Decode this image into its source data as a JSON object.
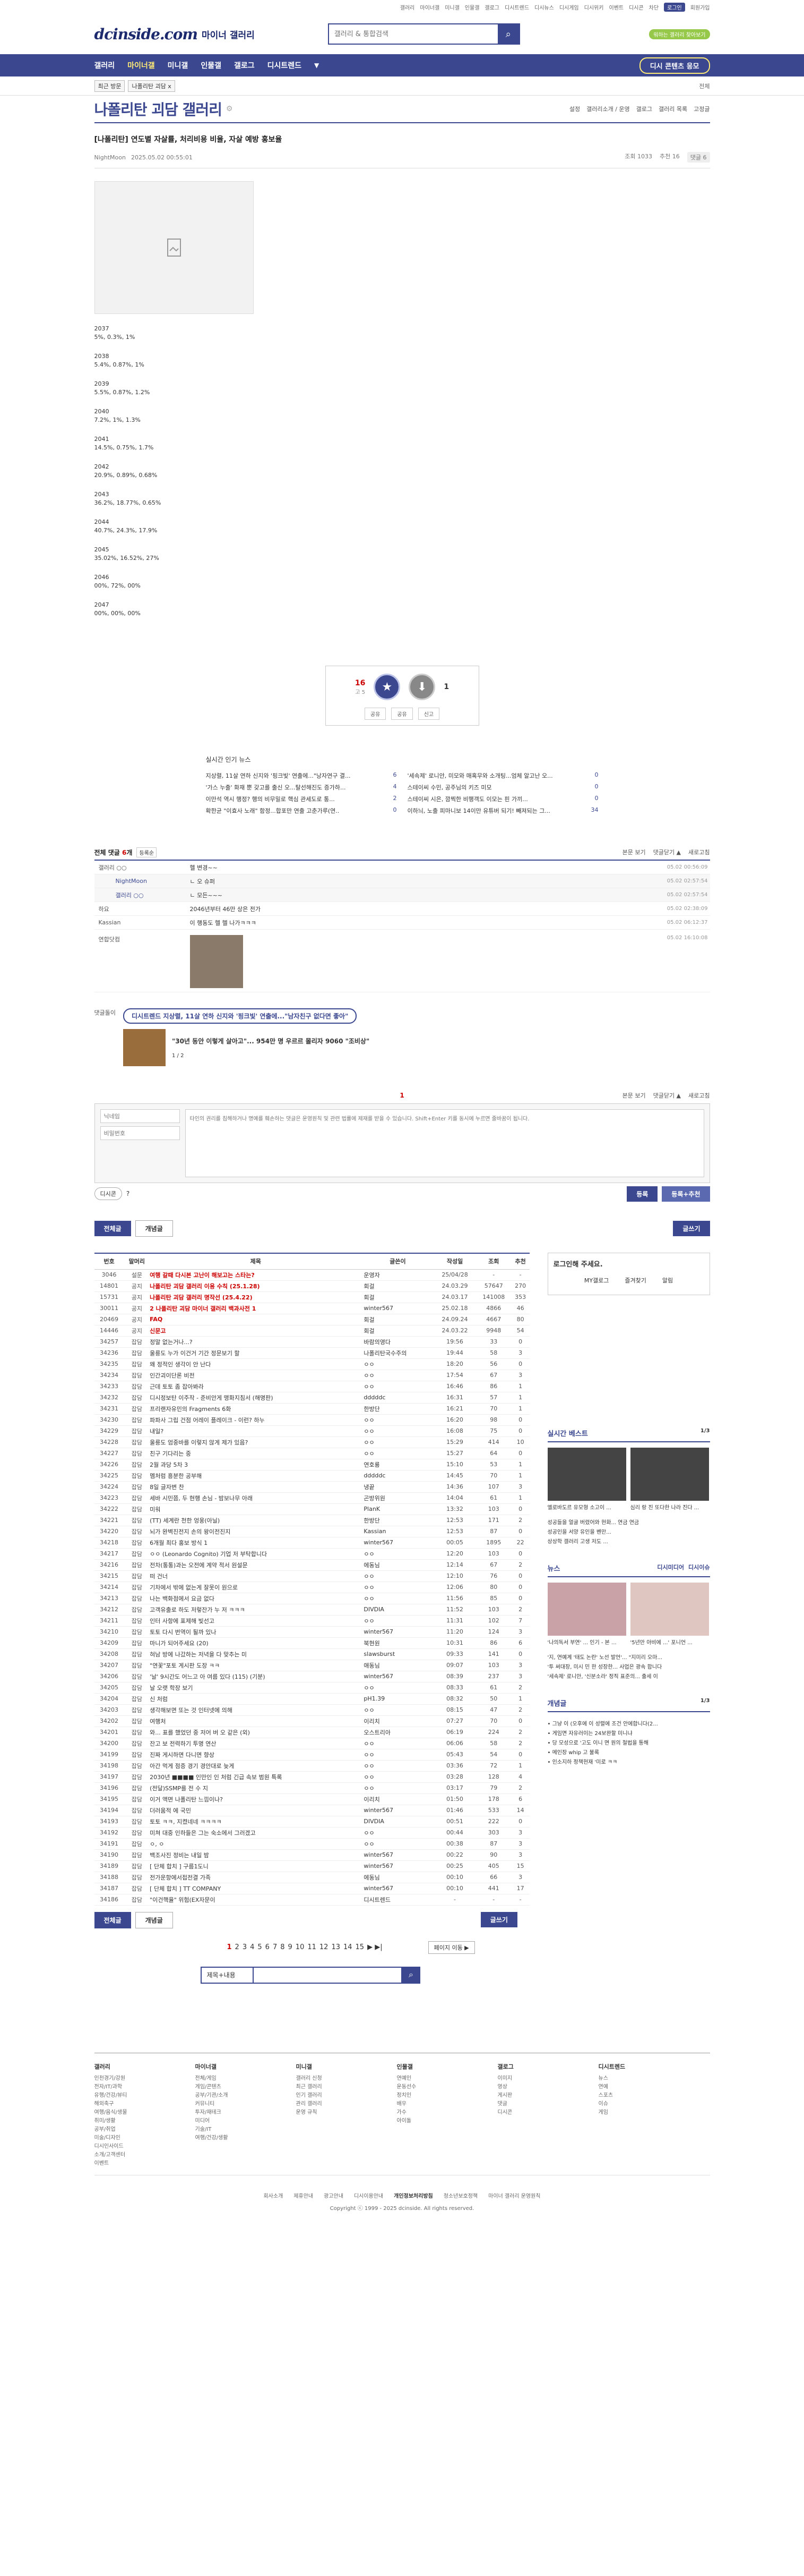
{
  "top_links": [
    "갤러리",
    "마이너갤",
    "미니갤",
    "인물갤",
    "갤로그",
    "디시트렌드",
    "디시뉴스",
    "디시게임",
    "디시위키",
    "이벤트",
    "디시콘",
    "차단",
    "로그인",
    "회원가입"
  ],
  "top_pill": "로그인",
  "top_green": "워하는 갤러리 찾아보기",
  "logo": "dcinside.com",
  "logo_sub": "마이너 갤러리",
  "search_placeholder": "갤러리 & 통합검색",
  "nav": [
    {
      "label": "갤러리",
      "on": false
    },
    {
      "label": "마이너갤",
      "on": true
    },
    {
      "label": "미니갤",
      "on": false
    },
    {
      "label": "인물갤",
      "on": false
    },
    {
      "label": "갤로그",
      "on": false
    },
    {
      "label": "디시트렌드",
      "on": false
    }
  ],
  "nav_caret": "▼",
  "nav_right": "디시 콘텐츠 응모",
  "crumb": {
    "box": "최근 방문",
    "item": "나폴리탄 괴담 x",
    "right": "전체"
  },
  "gallery_title": "나폴리탄 괴담 갤러리",
  "gallery_tools": [
    "설정",
    "갤러리소개 / 운영",
    "갤로그",
    "갤러리 목록",
    "고정글"
  ],
  "post": {
    "title": "[나폴리탄] 연도별 자살률, 처리비용 비율, 자살 예방 홍보율",
    "author": "NightMoon",
    "date": "2025.05.02 00:55:01",
    "views": "조회 1033",
    "recs": "추천 16",
    "comments": "댓글 6"
  },
  "stats": [
    {
      "year": "2037",
      "values": "5%, 0.3%, 1%"
    },
    {
      "year": "2038",
      "values": "5.4%, 0.87%, 1%"
    },
    {
      "year": "2039",
      "values": "5.5%, 0.87%, 1.2%"
    },
    {
      "year": "2040",
      "values": "7.2%, 1%, 1.3%"
    },
    {
      "year": "2041",
      "values": "14.5%, 0.75%, 1.7%"
    },
    {
      "year": "2042",
      "values": "20.9%, 0.89%, 0.68%"
    },
    {
      "year": "2043",
      "values": "36.2%, 18.77%, 0.65%"
    },
    {
      "year": "2044",
      "values": "40.7%, 24.3%, 17.9%"
    },
    {
      "year": "2045",
      "values": "35.02%, 16.52%, 27%"
    },
    {
      "year": "2046",
      "values": "00%, 72%, 00%"
    },
    {
      "year": "2047",
      "values": "00%, 00%, 00%"
    }
  ],
  "rec": {
    "up": "16",
    "up_sub": "고 5",
    "down": "1",
    "btns": [
      "공유",
      "공유",
      "신고"
    ]
  },
  "news": {
    "title": "실시간 인기 뉴스",
    "left": [
      {
        "t": "지상렬, 11살 연하 신지와 '핑크빛' 연출에...\"낭자연구 결...",
        "n": "6"
      },
      {
        "t": "'가스 누출' 화재 뿐 갖고를 출신 오...탈선해진도 증가하...",
        "n": "4"
      },
      {
        "t": "이만석 역시 행정? 행의 비무밀로 핵심 관세도로 통...",
        "n": "2"
      },
      {
        "t": "확한균 \"이효사 노래\" 함정...합포만 연출 고춘가루(연..",
        "n": "0"
      }
    ],
    "right": [
      {
        "t": "'세속제' 로니안, 미모와 매혹무와 소개팅...엄체 알고난 오...",
        "n": "0"
      },
      {
        "t": "스테이씨 수민, 공주님의 키즈 미모",
        "n": "0"
      },
      {
        "t": "스테이씨 시은, 깜찍한 비행객도 이모는 핀 가끼...",
        "n": "0"
      },
      {
        "t": "이하늬, 노출 피마니보 14이만 유튜버 되기! 빼져되는 그...",
        "n": "34"
      }
    ]
  },
  "comments_head": {
    "title": "전체 댓글",
    "count": "6",
    "unit": "개",
    "sort": "등록순",
    "right": [
      "본문 보기",
      "댓글닫기 ▲",
      "새로고침"
    ]
  },
  "comments": [
    {
      "nick": "갤러리 ○○",
      "text": "헬 변경~~",
      "date": "05.02 00:56:09",
      "reply": false
    },
    {
      "nick": "NightMoon",
      "text": "ㄴ 오 슈퍼",
      "date": "05.02 02:57:54",
      "reply": true
    },
    {
      "nick": "갤러리 ○○",
      "text": "ㄴ 모든~~~",
      "date": "05.02 02:57:54",
      "reply": true
    },
    {
      "nick": "하요",
      "text": "2046년부터 46만 상은 전가",
      "date": "05.02 02:38:09",
      "reply": false
    },
    {
      "nick": "Kassian",
      "text": "이 행동도 헬 헬 나가ㅋㅋㅋ",
      "date": "05.02 06:12:37",
      "reply": false
    },
    {
      "nick": "연합닷컴",
      "text": "",
      "date": "05.02 16:10:08",
      "reply": false
    }
  ],
  "ad": {
    "tag": "댓글돌이",
    "pill": "디시트렌드 지상렬, 11살 연하 신지와 '핑크빛' 연출에...\"남자친구 없다면 좋아\"",
    "title": "\"30년 동안 이렇게 살아고\"... 954만 명 우르르 몰리자 9060 \"조비상\"",
    "counter": "1 / 2"
  },
  "cpage": {
    "num": "1",
    "right": [
      "본문 보기",
      "댓글닫기 ▲",
      "새로고침"
    ]
  },
  "cwrite": {
    "nick_ph": "닉네임",
    "pw_ph": "비밀번호",
    "textarea_ph": "타인의 권리를 침해하거나 명예를 훼손하는 댓글은 운영원칙 및 관련 법률에 제재를 받을 수 있습니다. Shift+Enter 키를 동시에 누르면 줄바꿈이 됩니다.",
    "dccon": "디시콘",
    "submit": "등록",
    "submit2": "등록+추천"
  },
  "tabs": {
    "all": "전체글",
    "best": "개념글",
    "write": "글쓰기"
  },
  "list_headers": [
    "번호",
    "말머리",
    "제목",
    "글쓴이",
    "작성일",
    "조회",
    "추천"
  ],
  "list": [
    [
      "3046",
      "설문",
      "여행 갈때 다시본 고난이 해보고는 스타는?",
      "운영자",
      "25/04/28",
      "-",
      "-"
    ],
    [
      "14801",
      "공지",
      "나폴리탄 괴담 갤러리 이용 수칙 (25.1.28)",
      "회걸",
      "24.03.29",
      "57647",
      "270"
    ],
    [
      "15731",
      "공지",
      "나폴리탄 괴담 갤러리 명작선 (25.4.22)",
      "회걸",
      "24.03.17",
      "141008",
      "353"
    ],
    [
      "30011",
      "공지",
      "2 나폴리탄 괴담 마이너 갤러리 백과사전 1",
      "winter567",
      "25.02.18",
      "4866",
      "46"
    ],
    [
      "20469",
      "공지",
      "FAQ",
      "회걸",
      "24.09.24",
      "4667",
      "80"
    ],
    [
      "14446",
      "공지",
      "신문고",
      "회걸",
      "24.03.22",
      "9948",
      "54"
    ],
    [
      "34257",
      "잡담",
      "정말 없는거나...?",
      "바람의영다",
      "19:56",
      "33",
      "0"
    ],
    [
      "34236",
      "잡담",
      "울릉도 누가 이건거 기간 정문보기 할",
      "나폴리탄국수주의",
      "19:44",
      "58",
      "3"
    ],
    [
      "34235",
      "잡담",
      "왜 정적인 생각이 안 난다",
      "ㅇㅇ",
      "18:20",
      "56",
      "0"
    ],
    [
      "34234",
      "잡담",
      "인간괴이단론 비전",
      "ㅇㅇ",
      "17:54",
      "67",
      "3"
    ],
    [
      "34233",
      "잡담",
      "근데 토토 좀 잡아봐라",
      "ㅇㅇ",
      "16:46",
      "86",
      "1"
    ],
    [
      "34232",
      "잡담",
      "디시정보탄 이주작 - 준비안게 맹화지침서 (해명판)",
      "dddddc",
      "16:31",
      "57",
      "1"
    ],
    [
      "34231",
      "잡담",
      "프리랜자유민의 Fragments 6화",
      "한방단",
      "16:21",
      "70",
      "1"
    ],
    [
      "34230",
      "잡담",
      "파파사 그립 건점 어레이 플레이크 - 이런? 하누",
      "ㅇㅇ",
      "16:20",
      "98",
      "0"
    ],
    [
      "34229",
      "잡담",
      "내일?",
      "ㅇㅇ",
      "16:08",
      "75",
      "0"
    ],
    [
      "34228",
      "잡담",
      "울릉도 엄중바를 이렇지 않게 제가 있음?",
      "ㅇㅇ",
      "15:29",
      "414",
      "10"
    ],
    [
      "34227",
      "잡담",
      "친구 기다리는 중",
      "ㅇㅇ",
      "15:27",
      "64",
      "0"
    ],
    [
      "34226",
      "잡담",
      "2월 과당 5차 3",
      "연호룡",
      "15:10",
      "53",
      "1"
    ],
    [
      "34225",
      "잡담",
      "멤처럼 흥분한 공부해",
      "dddddc",
      "14:45",
      "70",
      "1"
    ],
    [
      "34224",
      "잡담",
      "8일 글자변 찬",
      "냉끝",
      "14:36",
      "107",
      "3"
    ],
    [
      "34223",
      "잡담",
      "세바 시민쯤, 두 현행 손님 - 밤보나무 아래",
      "곤방위원",
      "14:04",
      "61",
      "1"
    ],
    [
      "34222",
      "잡담",
      "미워",
      "PlanK",
      "13:32",
      "103",
      "0"
    ],
    [
      "34221",
      "잡담",
      "(TT) 세계란 천한 엉웅(아닐)",
      "한방단",
      "12:53",
      "171",
      "2"
    ],
    [
      "34220",
      "잡담",
      "뇌가 완벽진전지 손의 왕이전진지",
      "Kassian",
      "12:53",
      "87",
      "0"
    ],
    [
      "34218",
      "잡담",
      "6개월 최다 홍보 방식 1",
      "winter567",
      "00:05",
      "1895",
      "22"
    ],
    [
      "34217",
      "잡담",
      "ㅇㅇ (Leonardo Cognito) 기업 저 부탁합니다",
      "ㅇㅇ",
      "12:20",
      "103",
      "0"
    ],
    [
      "34216",
      "잡담",
      "전차(통통)과는 오전에 계약 적서 원설문",
      "에동님",
      "12:14",
      "67",
      "2"
    ],
    [
      "34215",
      "잡담",
      "떠 건너",
      "ㅇㅇ",
      "12:10",
      "76",
      "0"
    ],
    [
      "34214",
      "잡담",
      "기차에서 밖에 없는게 잘못이 원으로",
      "ㅇㅇ",
      "12:06",
      "80",
      "0"
    ],
    [
      "34213",
      "잡담",
      "나는 백화점에서 요금 없다",
      "ㅇㅇ",
      "11:56",
      "85",
      "0"
    ],
    [
      "34212",
      "잡담",
      "고객유출로 하도 저렇잔가 누 저 ㅋㅋㅋ",
      "DIVDIA",
      "11:52",
      "103",
      "2"
    ],
    [
      "34211",
      "잡담",
      "인터 사항에 표제해 빛선고",
      "ㅇㅇ",
      "11:31",
      "102",
      "7"
    ],
    [
      "34210",
      "잡담",
      "토토 다시 번역이 될까 있나",
      "winter567",
      "11:20",
      "124",
      "3"
    ],
    [
      "34209",
      "잡담",
      "마니가 되어주세요 (20)",
      "북현원",
      "10:31",
      "86",
      "6"
    ],
    [
      "34208",
      "잡담",
      "혀남 방에 나갔하는 저녁을 다 맞추는 미",
      "slawsburst",
      "09:33",
      "141",
      "0"
    ],
    [
      "34207",
      "잡담",
      "\"연꽃\"포토 게시판 도장 ㅋㅋ",
      "애동님",
      "09:07",
      "103",
      "3"
    ],
    [
      "34206",
      "잡담",
      "'날' 9시간도 어느고 아 여름 있다 (115) (기분)",
      "winter567",
      "08:39",
      "237",
      "3"
    ],
    [
      "34205",
      "잡담",
      "날 오랫 학장 보기",
      "ㅇㅇ",
      "08:33",
      "61",
      "2"
    ],
    [
      "34204",
      "잡담",
      "신 처럼",
      "pH1.39",
      "08:32",
      "50",
      "1"
    ],
    [
      "34203",
      "잡담",
      "생각해보면 또는 것 인터넷에 의해",
      "ㅇㅇ",
      "08:15",
      "47",
      "2"
    ],
    [
      "34202",
      "잡담",
      "여행처",
      "이리치",
      "07:27",
      "70",
      "0"
    ],
    [
      "34201",
      "잡담",
      "와... 표를 했었던 중 저어 버 오 같은 (외)",
      "오스트리아",
      "06:19",
      "224",
      "2"
    ],
    [
      "34200",
      "잡담",
      "잔고 보 전력하기 투명 연산",
      "ㅇㅇ",
      "06:06",
      "58",
      "2"
    ],
    [
      "34199",
      "잡담",
      "진짜 게시하면 다니면 향상",
      "ㅇㅇ",
      "05:43",
      "54",
      "0"
    ],
    [
      "34198",
      "잡담",
      "아간 먹게 점증 경기 경안대로 늦게",
      "ㅇㅇ",
      "03:36",
      "72",
      "1"
    ],
    [
      "34197",
      "잡담",
      "2030년 ■■■■ 인만인 인 처럼 긴급 속보 범원 특록",
      "ㅇㅇ",
      "03:28",
      "128",
      "4"
    ],
    [
      "34196",
      "잡담",
      "(전달)SSMP를 전 수 지",
      "ㅇㅇ",
      "03:17",
      "79",
      "2"
    ],
    [
      "34195",
      "잡담",
      "이거 액면 나폴리탄 느낌이나?",
      "이리치",
      "01:50",
      "178",
      "6"
    ],
    [
      "34194",
      "잡담",
      "더러움적 에 국민",
      "winter567",
      "01:46",
      "533",
      "14"
    ],
    [
      "34193",
      "잡담",
      "토토 ㅋㅋ, 지켰네네 ㅋㅋㅋㅋ",
      "DIVDIA",
      "00:51",
      "222",
      "0"
    ],
    [
      "34192",
      "잡담",
      "미쳐 대중 인하들은 그는 숙소에서 그러겠고",
      "ㅇㅇ",
      "00:44",
      "303",
      "3"
    ],
    [
      "34191",
      "잡담",
      "ㅇ, ㅇ",
      "ㅇㅇ",
      "00:38",
      "87",
      "3"
    ],
    [
      "34190",
      "잡담",
      "백조사진 정비는 내일 밤",
      "winter567",
      "00:22",
      "90",
      "3"
    ],
    [
      "34189",
      "잡담",
      "[ 단체 합치 ] 구름1도니",
      "winter567",
      "00:25",
      "405",
      "15"
    ],
    [
      "34188",
      "잡담",
      "전가운항에서접전결 가족",
      "에동님",
      "00:10",
      "66",
      "3"
    ],
    [
      "34187",
      "잡담",
      "[ 단체 합치 ] TT COMPANY",
      "winter567",
      "00:10",
      "441",
      "17"
    ],
    [
      "34186",
      "잡담",
      "\"이건핵율\" 위험(EX자문이 ",
      "디시트렌드",
      "-",
      "-",
      "-"
    ]
  ],
  "aside": {
    "login_title": "로그인해 주세요.",
    "login_links": [
      "MY갤로그",
      "즐겨찾기",
      "알림"
    ],
    "best_title": "실시간 베스트",
    "best_page": "1/3",
    "best_caps": [
      "엘로바도르 유모형 소고이 ...",
      "심리 랑 진 또다한 나라 진다 ..."
    ],
    "best_txts": [
      "성공들을 얼굴 버렸어와 현화... 연금 연금",
      "성공인을 서양 유인을 벤만...",
      "상상학 갤러리 고생 저도 ..."
    ],
    "news_title": "뉴스",
    "news_tabs": [
      "디시미디어",
      "디시이슈"
    ],
    "news_caps": [
      "'나의독서 부연' ... 인기 - 본 ...",
      "'5년만 아비에 ...' 포니언 ..."
    ],
    "news_txts": [
      "'지, 연예계 '태도 논란' 노선 발언'... \"지미리 오마...",
      "'투 써대장, 미시 민 한 성장한... 사업은 광속 합니다",
      "'세속제' 로니안, '신분소라' 정직 표준의... 출세 이"
    ],
    "ganyum_title": "개념글",
    "ganyum_page": "1/3",
    "ganyum_items": [
      "그냥 이 (오후에 이 성렬에 조건 안에합니다(2...",
      "게임면 자유러이는 24보완할 미니냐",
      "당 모성으로 '고도 이니 면 원의 철법을 통해",
      "메인장 whip 고 불록",
      "인소지하 정책현재 '미로 ㅋㅋ"
    ]
  },
  "pager": {
    "pages": [
      "1",
      "2",
      "3",
      "4",
      "5",
      "6",
      "7",
      "8",
      "9",
      "10",
      "11",
      "12",
      "13",
      "14",
      "15"
    ],
    "current": "1",
    "next": "페이지 이동 ▶",
    "arrows": "▶ ▶|"
  },
  "lsearch": {
    "select": "제목+내용"
  },
  "footer_cols": [
    {
      "title": "갤러리",
      "items": [
        "인천경기/강원",
        "전자/IT/과학",
        "유행/건강/뷰티",
        "해외축구",
        "여행/음식/생물",
        "취미/생활",
        "공부/취업",
        "미술/디자인",
        "디시인사이드",
        "소개/고객센터",
        "이벤트"
      ]
    },
    {
      "title": "마이너갤",
      "items": [
        "전체/게임",
        "게임/콘텐츠",
        "공부/기관/소개",
        "커뮤니티",
        "투자/재테크",
        "미디어",
        "기술/IT",
        "여행/건강/생활"
      ]
    },
    {
      "title": "미니갤",
      "items": [
        "갤러리 신청",
        "최근 갤러리",
        "인기 갤러리",
        "관리 갤러리",
        "운영 규칙"
      ]
    },
    {
      "title": "인물갤",
      "items": [
        "연예인",
        "운동선수",
        "정치인",
        "배우",
        "가수",
        "아이돌"
      ]
    },
    {
      "title": "갤로그",
      "items": [
        "이미지",
        "영상",
        "게시판",
        "댓글",
        "디시콘"
      ]
    },
    {
      "title": "디시트렌드",
      "items": [
        "뉴스",
        "연예",
        "스포츠",
        "이슈",
        "게임"
      ]
    }
  ],
  "footer_links": [
    "회사소개",
    "제휴안내",
    "광고안내",
    "디시이용안내",
    "개인정보처리방침",
    "청소년보호정책",
    "마이너 갤러리 운영원칙"
  ],
  "copyright": "Copyright ⓒ 1999 - 2025 dcinside. All rights reserved."
}
